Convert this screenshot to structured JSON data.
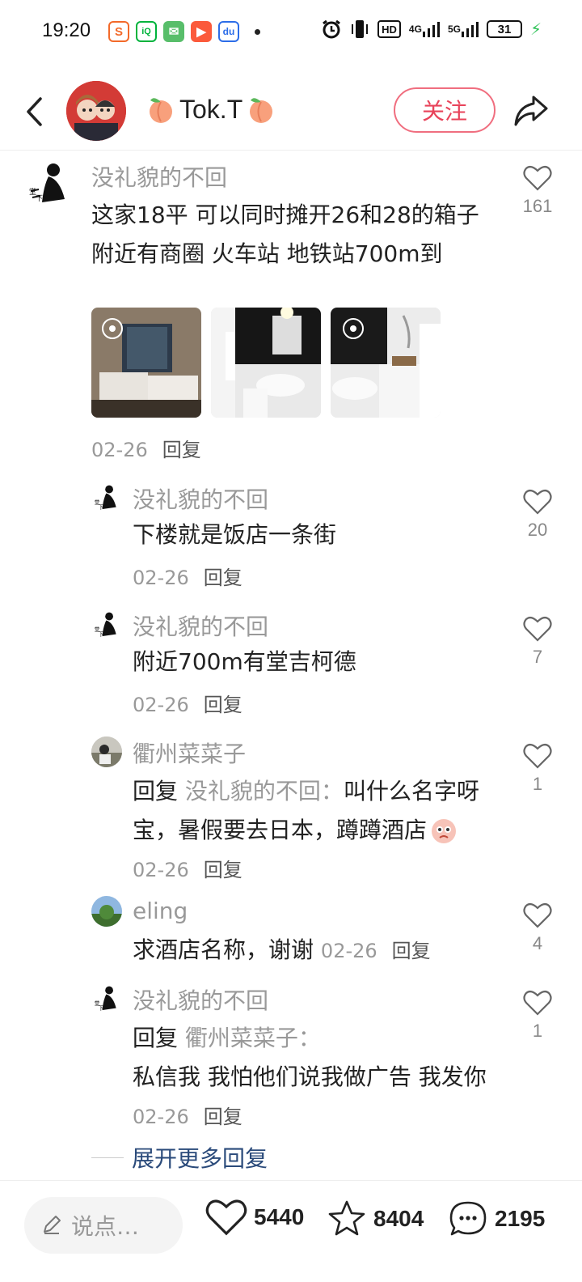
{
  "status": {
    "time": "19:20",
    "app_icons": [
      "sohu-icon",
      "iqiyi-icon",
      "wechat-icon",
      "video-icon",
      "baidu-icon"
    ],
    "hd": "HD",
    "net1": "4G",
    "net2": "5G",
    "battery": "31"
  },
  "header": {
    "author_name": "Tok.T",
    "follow_label": "关注"
  },
  "comments": [
    {
      "name": "没礼貌的不回",
      "text": "这家18平 可以同时摊开26和28的箱子 附近有商圈 火车站 地铁站700m到",
      "date": "02-26",
      "reply": "回复",
      "likes": "161"
    },
    {
      "name": "没礼貌的不回",
      "text": "下楼就是饭店一条街",
      "date": "02-26",
      "reply": "回复",
      "likes": "20"
    },
    {
      "name": "没礼貌的不回",
      "text": "附近700m有堂吉柯德",
      "date": "02-26",
      "reply": "回复",
      "likes": "7"
    },
    {
      "name": "衢州菜菜子",
      "reply_prefix": "回复",
      "reply_to": "没礼貌的不回：",
      "text": "叫什么名字呀宝，暑假要去日本，蹲蹲酒店",
      "date": "02-26",
      "reply": "回复",
      "likes": "1"
    },
    {
      "name": "eling",
      "text": "求酒店名称，谢谢",
      "date": "02-26",
      "reply": "回复",
      "likes": "4"
    },
    {
      "name": "没礼貌的不回",
      "reply_prefix": "回复",
      "reply_to": "衢州菜菜子：",
      "text": "私信我 我怕他们说我做广告 我发你",
      "date": "02-26",
      "reply": "回复",
      "likes": "1"
    }
  ],
  "expand_label": "展开更多回复",
  "bottom": {
    "input_placeholder": "说点…",
    "likes": "5440",
    "favorites": "8404",
    "comments": "2195"
  },
  "colors": {
    "follow": "#e8435a",
    "link": "#2a4a7a",
    "muted": "#999999"
  }
}
